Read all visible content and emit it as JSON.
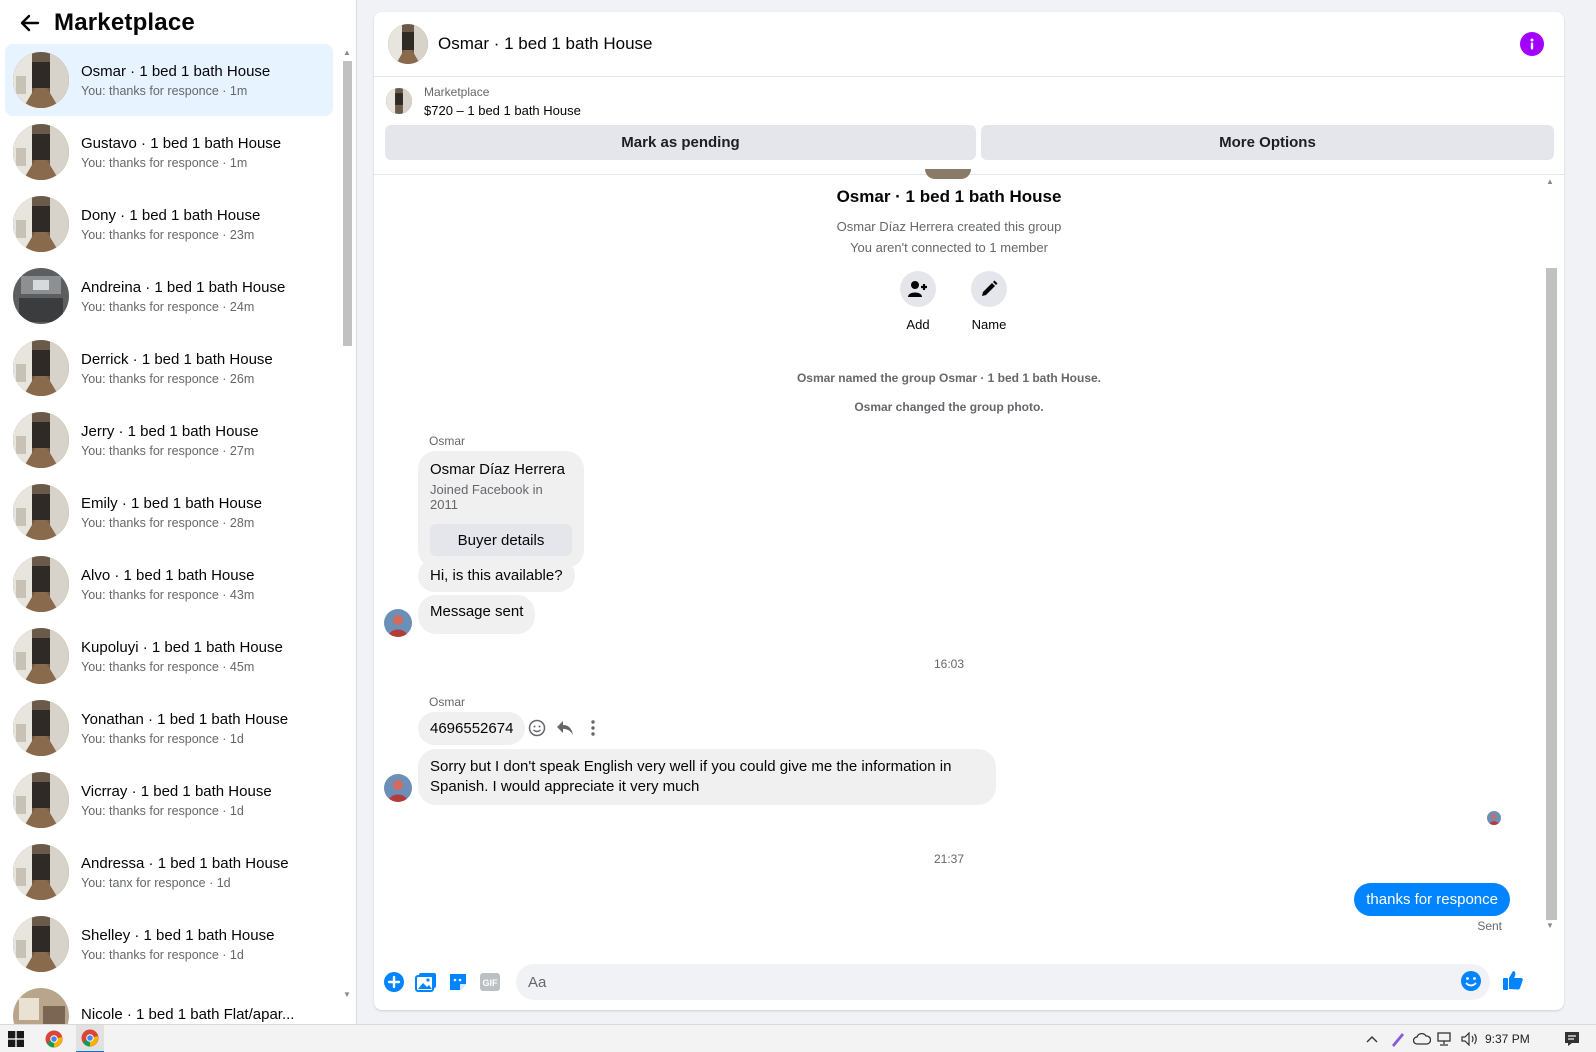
{
  "sidebar": {
    "title": "Marketplace",
    "conversations": [
      {
        "name": "Osmar · 1 bed 1 bath House",
        "snippet": "You: thanks for responce · 1m",
        "active": true,
        "photo": "hallway"
      },
      {
        "name": "Gustavo · 1 bed 1 bath House",
        "snippet": "You: thanks for responce · 1m",
        "photo": "hallway"
      },
      {
        "name": "Dony · 1 bed 1 bath House",
        "snippet": "You: thanks for responce · 23m",
        "photo": "hallway"
      },
      {
        "name": "Andreina · 1 bed 1 bath House",
        "snippet": "You: thanks for responce · 24m",
        "photo": "kitchen"
      },
      {
        "name": "Derrick · 1 bed 1 bath House",
        "snippet": "You: thanks for responce · 26m",
        "photo": "hallway"
      },
      {
        "name": "Jerry · 1 bed 1 bath House",
        "snippet": "You: thanks for responce · 27m",
        "photo": "hallway"
      },
      {
        "name": "Emily · 1 bed 1 bath House",
        "snippet": "You: thanks for responce · 28m",
        "photo": "hallway"
      },
      {
        "name": "Alvo · 1 bed 1 bath House",
        "snippet": "You: thanks for responce · 43m",
        "photo": "hallway"
      },
      {
        "name": "Kupoluyi · 1 bed 1 bath House",
        "snippet": "You: thanks for responce · 45m",
        "photo": "hallway"
      },
      {
        "name": "Yonathan · 1 bed 1 bath House",
        "snippet": "You: thanks for responce · 1d",
        "photo": "hallway"
      },
      {
        "name": "Vicrray · 1 bed 1 bath House",
        "snippet": "You: thanks for responce · 1d",
        "photo": "hallway"
      },
      {
        "name": "Andressa · 1 bed 1 bath House",
        "snippet": "You: tanx for responce · 1d",
        "photo": "hallway"
      },
      {
        "name": "Shelley · 1 bed 1 bath House",
        "snippet": "You: thanks for responce · 1d",
        "photo": "hallway"
      },
      {
        "name": "Nicole · 1 bed 1 bath Flat/apar...",
        "snippet": "",
        "photo": "room",
        "unread": true
      }
    ]
  },
  "chat": {
    "title": "Osmar · 1 bed 1 bath House",
    "listing_source": "Marketplace",
    "listing_title": "$720 – 1 bed 1 bath House",
    "mark_pending_label": "Mark as pending",
    "more_options_label": "More Options",
    "group_title": "Osmar · 1 bed 1 bath House",
    "group_created": "Osmar Díaz Herrera created this group",
    "group_connected": "You aren't connected to 1 member",
    "add_label": "Add",
    "name_label": "Name",
    "system_1": "Osmar named the group Osmar · 1 bed 1 bath House.",
    "system_2": "Osmar changed the group photo.",
    "sender_1": "Osmar",
    "profile_name": "Osmar Díaz Herrera",
    "profile_joined": "Joined Facebook in 2011",
    "buyer_details_label": "Buyer details",
    "msg_available": "Hi, is this available?",
    "msg_sent": "Message sent",
    "time_1": "16:03",
    "sender_2": "Osmar",
    "msg_phone": "4696552674",
    "msg_spanish": "Sorry but I don't speak English very well if you could give me the information in Spanish. I would appreciate it very much",
    "time_2": "21:37",
    "msg_out": "thanks for responce",
    "status_sent": "Sent",
    "composer_placeholder": "Aa"
  },
  "taskbar": {
    "time": "9:37 PM"
  },
  "colors": {
    "accent": "#0084ff",
    "active_row": "#e7f3ff",
    "info": "#a100ff",
    "bubble": "#f0f0f0"
  }
}
